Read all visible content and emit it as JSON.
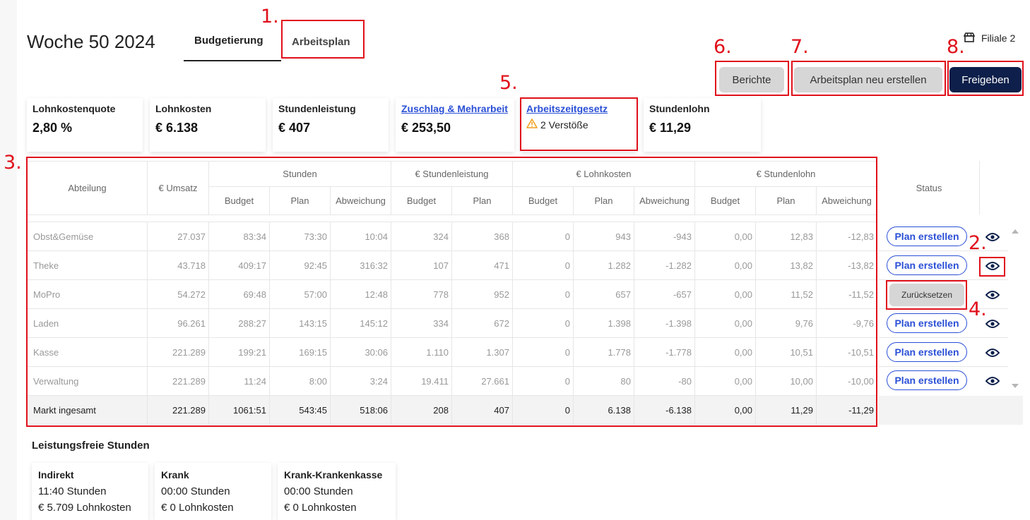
{
  "header": {
    "title": "Woche 50 2024",
    "tabs": [
      {
        "label": "Budgetierung",
        "active": true
      },
      {
        "label": "Arbeitsplan",
        "active": false
      }
    ],
    "store": "Filiale 2",
    "buttons": {
      "reports": "Berichte",
      "recreate": "Arbeitsplan neu erstellen",
      "release": "Freigeben"
    }
  },
  "kpis": [
    {
      "label": "Lohnkostenquote",
      "value": "2,80 %"
    },
    {
      "label": "Lohnkosten",
      "value": "€ 6.138"
    },
    {
      "label": "Stundenleistung",
      "value": "€ 407"
    },
    {
      "label": "Zuschlag & Mehrarbeit",
      "value": "€ 253,50",
      "link": true
    },
    {
      "label": "Arbeitszeitgesetz",
      "value": "2 Verstöße",
      "link": true
    },
    {
      "label": "Stundenlohn",
      "value": "€ 11,29"
    }
  ],
  "table": {
    "groups": {
      "dept": "Abteilung",
      "umsatz": "€ Umsatz",
      "stunden": "Stunden",
      "stundenleistung": "€ Stundenleistung",
      "lohnkosten": "€ Lohnkosten",
      "stundenlohn": "€ Stundenlohn",
      "status": "Status"
    },
    "sub": {
      "budget": "Budget",
      "plan": "Plan",
      "abw": "Abweichung"
    },
    "rows": [
      {
        "dept": "Obst&Gemüse",
        "cells": [
          "27.037",
          "83:34",
          "73:30",
          "10:04",
          "324",
          "368",
          "0",
          "943",
          "-943",
          "0,00",
          "12,83",
          "-12,83"
        ],
        "status": "Plan erstellen"
      },
      {
        "dept": "Theke",
        "cells": [
          "43.718",
          "409:17",
          "92:45",
          "316:32",
          "107",
          "471",
          "0",
          "1.282",
          "-1.282",
          "0,00",
          "13,82",
          "-13,82"
        ],
        "status": "Plan erstellen"
      },
      {
        "dept": "MoPro",
        "cells": [
          "54.272",
          "69:48",
          "57:00",
          "12:48",
          "778",
          "952",
          "0",
          "657",
          "-657",
          "0,00",
          "11,52",
          "-11,52"
        ],
        "status": "Zurücksetzen"
      },
      {
        "dept": "Laden",
        "cells": [
          "96.261",
          "288:27",
          "143:15",
          "145:12",
          "334",
          "672",
          "0",
          "1.398",
          "-1.398",
          "0,00",
          "9,76",
          "-9,76"
        ],
        "status": "Plan erstellen"
      },
      {
        "dept": "Kasse",
        "cells": [
          "221.289",
          "199:21",
          "169:15",
          "30:06",
          "1.110",
          "1.307",
          "0",
          "1.778",
          "-1.778",
          "0,00",
          "10,51",
          "-10,51"
        ],
        "status": "Plan erstellen"
      },
      {
        "dept": "Verwaltung",
        "cells": [
          "221.289",
          "11:24",
          "8:00",
          "3:24",
          "19.411",
          "27.661",
          "0",
          "80",
          "-80",
          "0,00",
          "10,00",
          "-10,00"
        ],
        "status": "Plan erstellen"
      }
    ],
    "total": {
      "dept": "Markt ingesamt",
      "cells": [
        "221.289",
        "1061:51",
        "543:45",
        "518:06",
        "208",
        "407",
        "0",
        "6.138",
        "-6.138",
        "0,00",
        "11,29",
        "-11,29"
      ]
    }
  },
  "leistungsfrei": {
    "title": "Leistungsfreie Stunden",
    "cards": [
      {
        "label": "Indirekt",
        "hours": "11:40 Stunden",
        "cost": "€ 5.709 Lohnkosten"
      },
      {
        "label": "Krank",
        "hours": "00:00 Stunden",
        "cost": "€ 0 Lohnkosten"
      },
      {
        "label": "Krank-Krankenkasse",
        "hours": "00:00 Stunden",
        "cost": "€ 0 Lohnkosten"
      }
    ]
  },
  "annotations": [
    "1.",
    "2.",
    "3.",
    "4.",
    "5.",
    "6.",
    "7.",
    "8."
  ],
  "colors": {
    "annotation": "#e0101b",
    "link": "#2a4fd6",
    "primary_button": "#0d1f4a",
    "warning": "#f0a020"
  }
}
